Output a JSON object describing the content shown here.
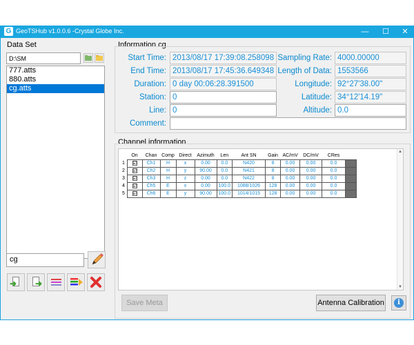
{
  "app": {
    "title": "GeoTSHub v1.0.0.6 -Crystal Globe Inc.",
    "icon_letter": "G"
  },
  "window_controls": {
    "minimize": "—",
    "maximize": "☐",
    "close": "✕"
  },
  "data_set": {
    "title": "Data Set",
    "path": "D:\\SM",
    "files": [
      "777.atts",
      "880.atts",
      "cg.atts"
    ],
    "selected_index": 2,
    "name_value": "cg"
  },
  "info": {
    "title": "Information cg",
    "start_time_label": "Start Time:",
    "start_time": "2013/08/17 17:39:08.258098",
    "end_time_label": "End Time:",
    "end_time": "2013/08/17 17:45:36.649348",
    "duration_label": "Duration:",
    "duration": "0 day 00:06:28.391500",
    "station_label": "Station:",
    "station": "0",
    "line_label": "Line:",
    "line": "0",
    "comment_label": "Comment:",
    "comment": "",
    "sampling_rate_label": "Sampling Rate:",
    "sampling_rate": "4000.00000",
    "length_label": "Length of Data:",
    "length": "1553566",
    "longitude_label": "Longitude:",
    "longitude": "92°27'38.00\"",
    "latitude_label": "Latitude:",
    "latitude": "34°12'14.19\"",
    "altitude_label": "Altitude:",
    "altitude": "0.0"
  },
  "channels": {
    "title": "Channel information",
    "headers": [
      "On",
      "Chan",
      "Comp",
      "Direct",
      "Azimuth",
      "Len",
      "Ant SN",
      "Gain",
      "AC/mV",
      "DC/mV",
      "CRes"
    ],
    "rows": [
      {
        "n": "1",
        "on": "☑",
        "chan": "Ch1",
        "comp": "H",
        "direct": "x",
        "azimuth": "0.00",
        "len": "0.0",
        "ant_sn": "N420",
        "gain": "8",
        "ac": "0.00",
        "dc": "0.00",
        "cres": "0.0"
      },
      {
        "n": "2",
        "on": "☑",
        "chan": "Ch2",
        "comp": "H",
        "direct": "y",
        "azimuth": "90.00",
        "len": "0.0",
        "ant_sn": "N421",
        "gain": "8",
        "ac": "0.00",
        "dc": "0.00",
        "cres": "0.0"
      },
      {
        "n": "3",
        "on": "☑",
        "chan": "Ch3",
        "comp": "H",
        "direct": "z",
        "azimuth": "0.00",
        "len": "0.0",
        "ant_sn": "N422",
        "gain": "8",
        "ac": "0.00",
        "dc": "0.00",
        "cres": "0.0"
      },
      {
        "n": "4",
        "on": "☑",
        "chan": "Ch5",
        "comp": "E",
        "direct": "x",
        "azimuth": "0.00",
        "len": "100.0",
        "ant_sn": "1088/1026",
        "gain": "128",
        "ac": "0.00",
        "dc": "0.00",
        "cres": "0.0"
      },
      {
        "n": "5",
        "on": "☑",
        "chan": "Ch6",
        "comp": "E",
        "direct": "y",
        "azimuth": "90.00",
        "len": "100.0",
        "ant_sn": "1014/1015",
        "gain": "128",
        "ac": "0.00",
        "dc": "0.00",
        "cres": "0.0"
      }
    ]
  },
  "buttons": {
    "save_meta": "Save Meta",
    "antenna_calibration": "Antenna Calibration",
    "info": "i"
  },
  "colors": {
    "titlebar": "#1aa7e0",
    "label_blue": "#0a8ad0",
    "selection": "#0078d7"
  }
}
